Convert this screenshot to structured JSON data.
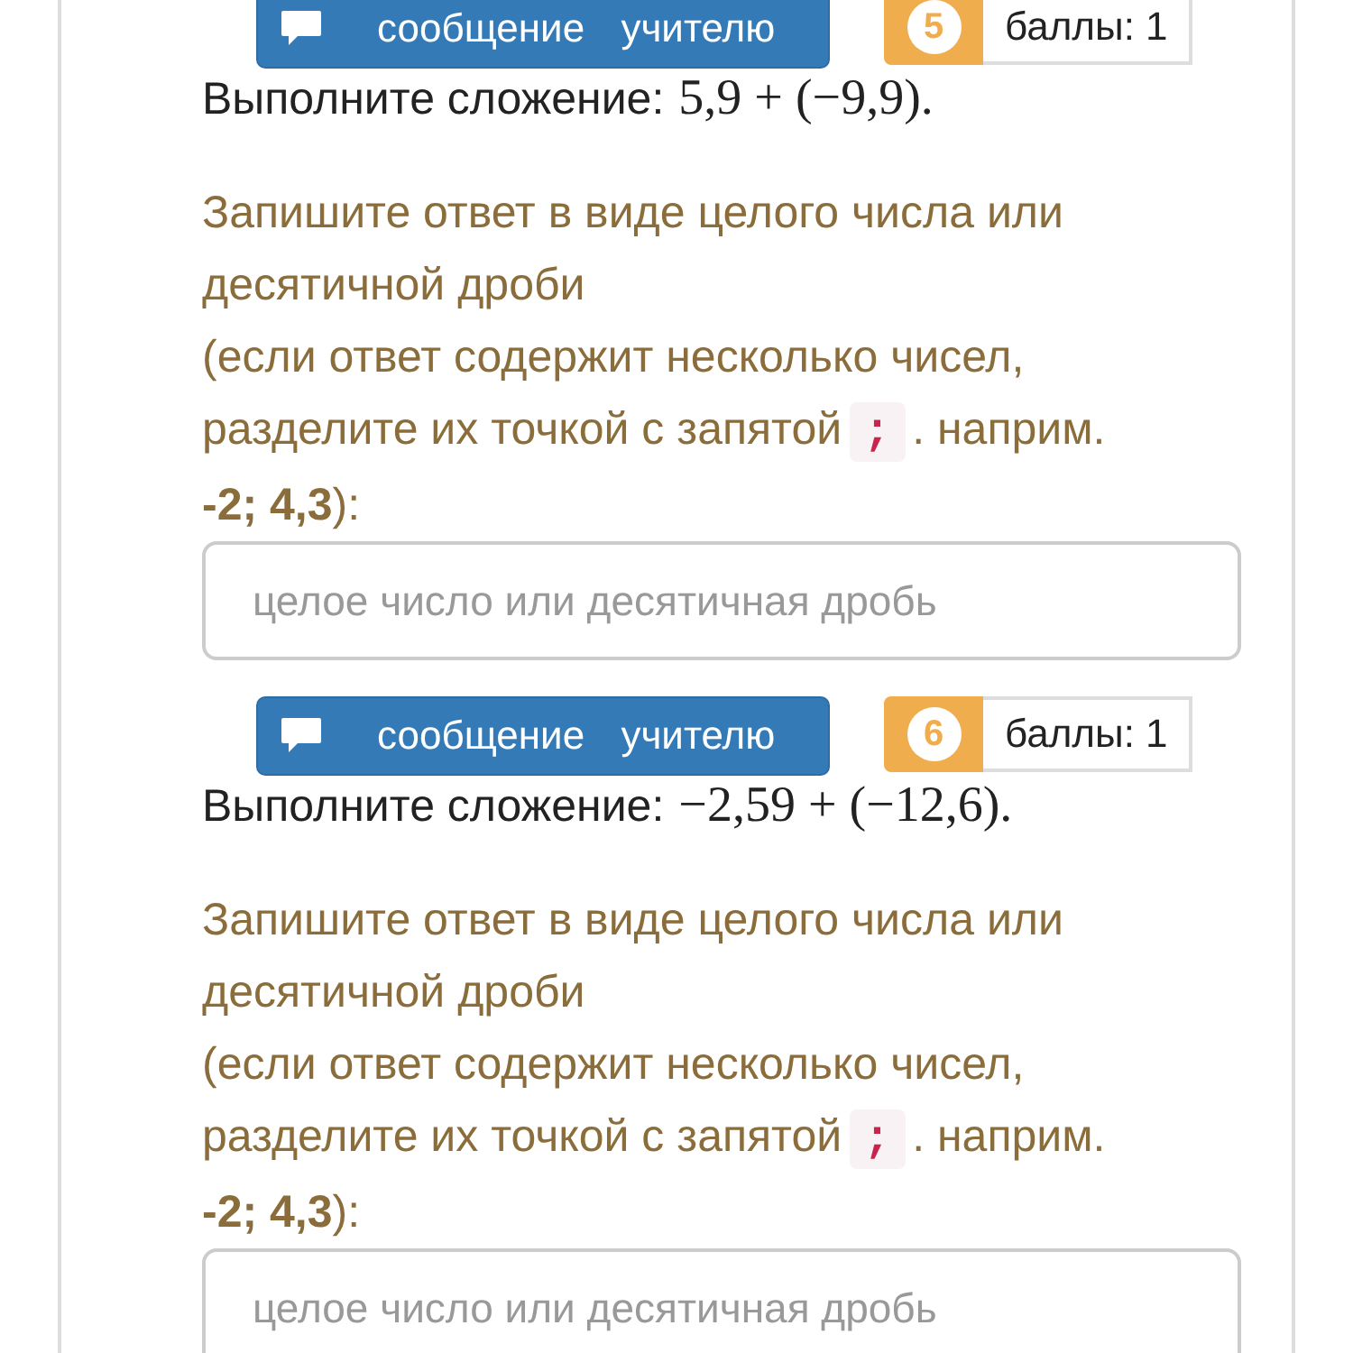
{
  "questions": [
    {
      "button": "сообщение учителю",
      "number": "5",
      "points": "баллы: 1",
      "prompt": "Выполните сложение:",
      "expression": "5,9 + (−9,9).",
      "instruction": "Запишите ответ в виде целого числа или десятичной дроби",
      "hint_line": "(если ответ содержит несколько чисел,",
      "hint_before": "разделите их точкой с запятой",
      "separator": ";",
      "hint_after": ". наприм.",
      "example": "**-2; 4,3**):",
      "placeholder": "целое число или десятичная дробь"
    },
    {
      "button": "сообщение учителю",
      "number": "6",
      "points": "баллы: 1",
      "prompt": "Выполните сложение:",
      "expression": "−2,59 + (−12,6).",
      "instruction": "Запишите ответ в виде целого числа или десятичной дроби",
      "hint_line": "(если ответ содержит несколько чисел,",
      "hint_before": "разделите их точкой с запятой",
      "separator": ";",
      "hint_after": ". наприм.",
      "example": "**-2; 4,3**):",
      "placeholder": "целое число или десятичная дробь"
    }
  ]
}
